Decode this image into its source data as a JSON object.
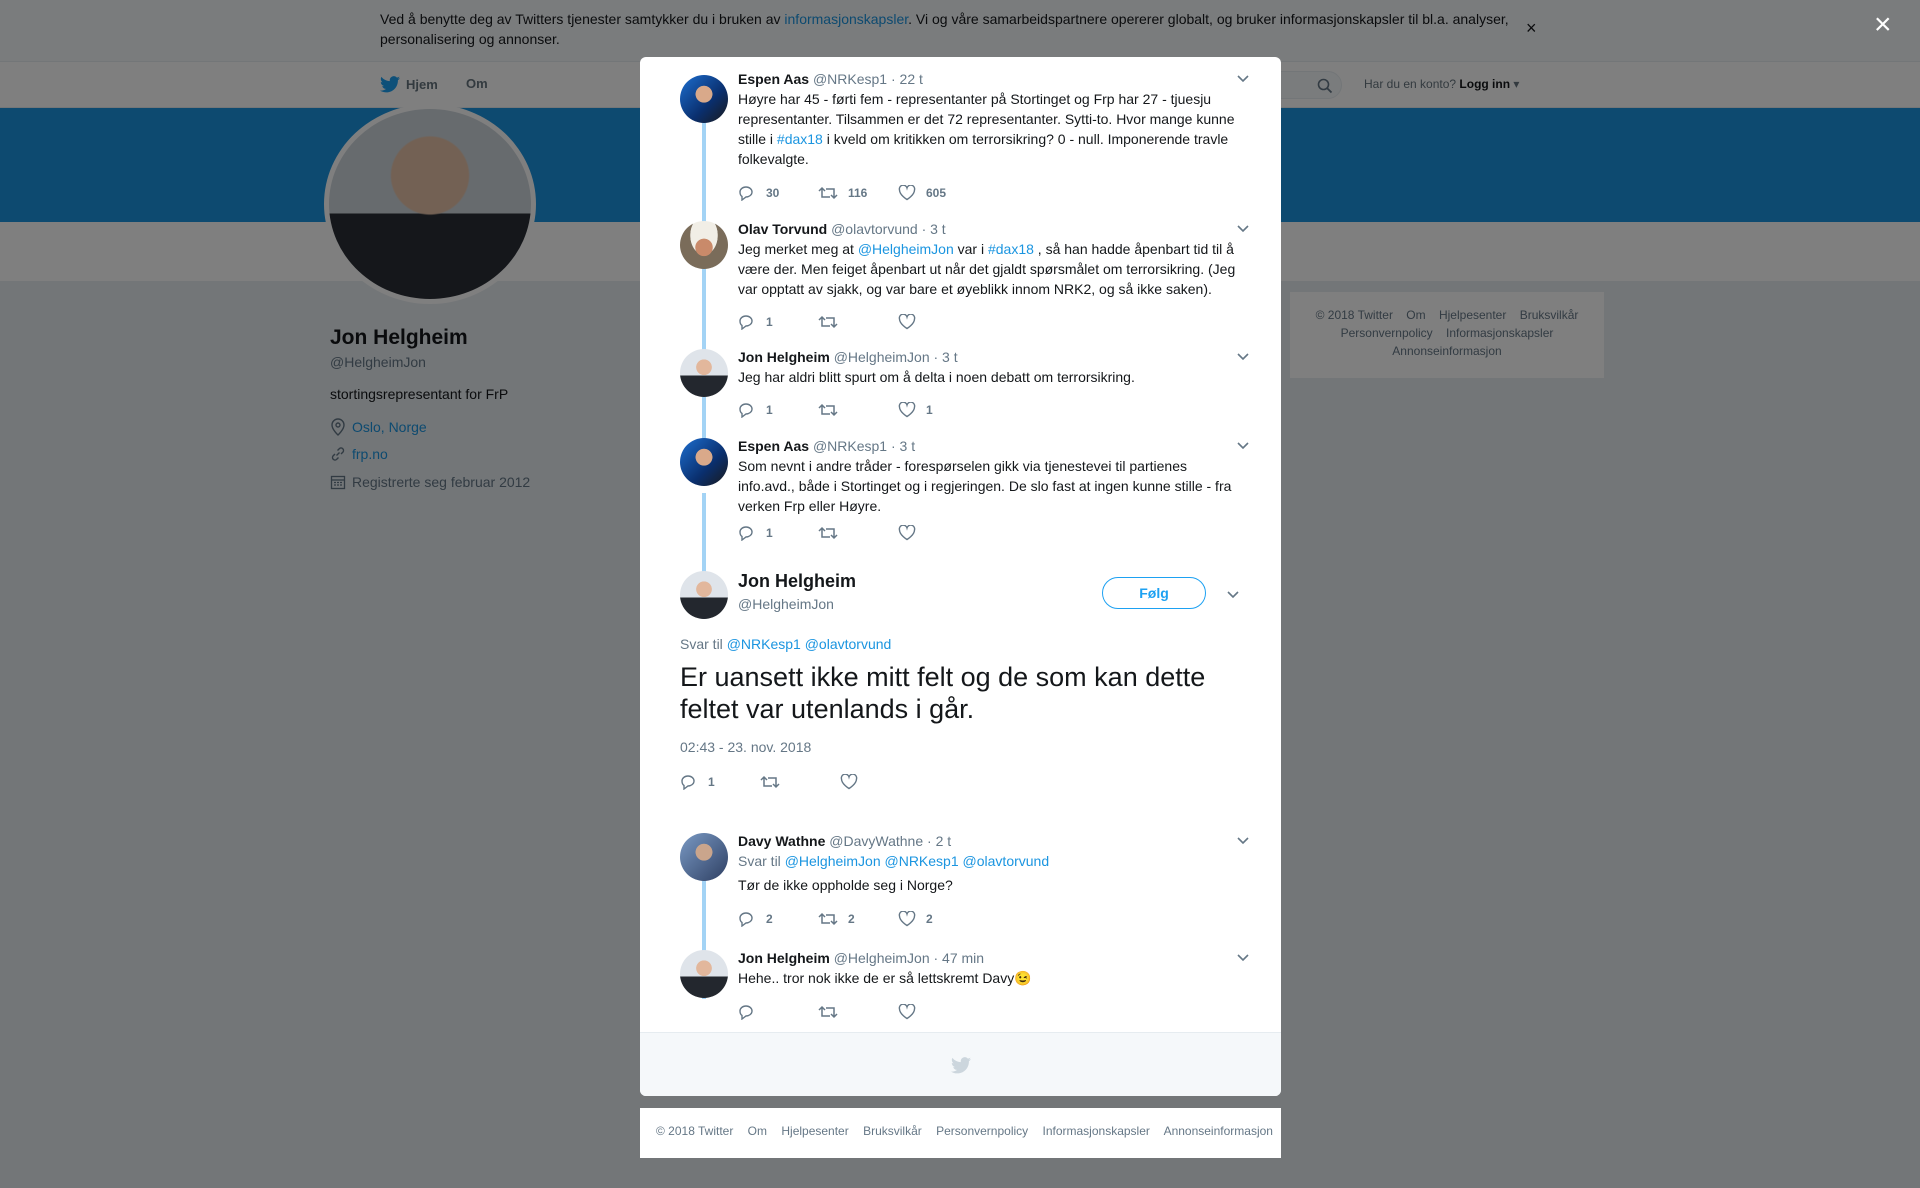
{
  "cookie": {
    "text_before": "Ved å benytte deg av Twitters tjenester samtykker du i bruken av ",
    "link": "informasjonskapsler",
    "text_after": ". Vi og våre samarbeidspartnere opererer globalt, og bruker informasjonskapsler til bl.a. analyser, personalisering og annonser.",
    "close": "×"
  },
  "nav": {
    "home": "Hjem",
    "about": "Om",
    "account_prompt": "Har du en konto?",
    "login": "Logg inn"
  },
  "profile": {
    "name": "Jon Helgheim",
    "handle": "@HelgheimJon",
    "bio": "stortingsrepresentant for FrP",
    "location": "Oslo, Norge",
    "website": "frp.no",
    "joined": "Registrerte seg februar 2012"
  },
  "side_footer": [
    "© 2018 Twitter",
    "Om",
    "Hjelpesenter",
    "Bruksvilkår",
    "Personvernpolicy",
    "Informasjonskapsler",
    "Annonseinformasjon"
  ],
  "modal_close": "×",
  "tweets": [
    {
      "name": "Espen Aas",
      "handle": "@NRKesp1",
      "time": "· 22 t",
      "text_parts": [
        "Høyre har 45 - førti fem - representanter på Stortinget og Frp har 27 - tjuesju representanter. Tilsammen er det 72 representanter. Sytti-to. Hvor mange kunne stille i ",
        "#dax18",
        " i kveld om kritikken om terrorsikring? 0 - null. Imponerende travle folkevalgte."
      ],
      "replies": "30",
      "retweets": "116",
      "likes": "605"
    },
    {
      "name": "Olav Torvund",
      "handle": "@olavtorvund",
      "time": "· 3 t",
      "text_parts": [
        "Jeg merket meg at ",
        "@HelgheimJon",
        " var i ",
        "#dax18",
        " , så han hadde åpenbart tid til å være der. Men feiget åpenbart ut når det gjaldt spørsmålet om terrorsikring. (Jeg var opptatt av sjakk, og var bare et øyeblikk innom NRK2, og så ikke saken)."
      ],
      "replies": "1",
      "retweets": "",
      "likes": ""
    },
    {
      "name": "Jon Helgheim",
      "handle": "@HelgheimJon",
      "time": "· 3 t",
      "text": "Jeg har aldri blitt spurt om å delta i noen debatt om terrorsikring.",
      "replies": "1",
      "retweets": "",
      "likes": "1"
    },
    {
      "name": "Espen Aas",
      "handle": "@NRKesp1",
      "time": "· 3 t",
      "text": "Som nevnt i andre tråder - forespørselen gikk via tjenestevei til partienes info.avd., både i Stortinget og i regjeringen. De slo fast at ingen kunne stille - fra verken Frp eller Høyre.",
      "replies": "1",
      "retweets": "",
      "likes": ""
    }
  ],
  "main_tweet": {
    "name": "Jon Helgheim",
    "handle": "@HelgheimJon",
    "follow": "Følg",
    "reply_label": "Svar til",
    "reply_to_1": "@NRKesp1",
    "reply_to_2": "@olavtorvund",
    "text": "Er uansett ikke mitt felt og de som kan dette feltet var utenlands i går.",
    "timestamp": "02:43 - 23. nov. 2018",
    "replies": "1",
    "retweets": "",
    "likes": ""
  },
  "replies": [
    {
      "name": "Davy Wathne",
      "handle": "@DavyWathne",
      "time": "· 2 t",
      "reply_label": "Svar til",
      "reply_to": [
        "@HelgheimJon",
        "@NRKesp1",
        "@olavtorvund"
      ],
      "text": "Tør de ikke oppholde seg i Norge?",
      "replies": "2",
      "retweets": "2",
      "likes": "2"
    },
    {
      "name": "Jon Helgheim",
      "handle": "@HelgheimJon",
      "time": "· 47 min",
      "text": "Hehe.. tror nok ikke de er så lettskremt Davy",
      "emoji": "😉",
      "replies": "",
      "retweets": "",
      "likes": ""
    }
  ],
  "page_footer": [
    "© 2018 Twitter",
    "Om",
    "Hjelpesenter",
    "Bruksvilkår",
    "Personvernpolicy",
    "Informasjonskapsler",
    "Annonseinformasjon"
  ],
  "colors": {
    "accent": "#1da1f2",
    "link": "#1b95e0",
    "thread": "#a3d3f5",
    "muted": "#657786"
  }
}
